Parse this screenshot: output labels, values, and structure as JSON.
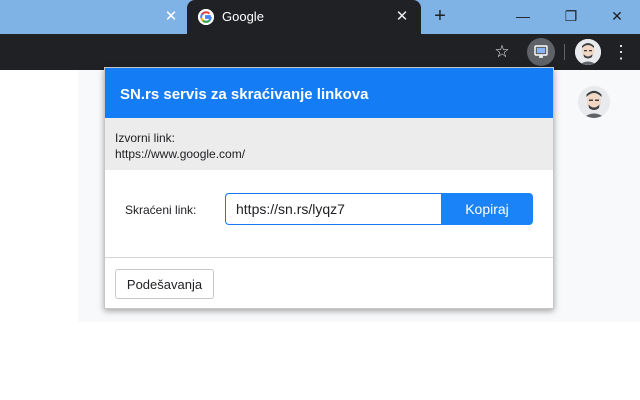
{
  "browser": {
    "tab": {
      "title": "Google",
      "close_glyph": "✕",
      "favicon": "google-g-icon"
    },
    "prev_tab_close_glyph": "✕",
    "new_tab_glyph": "+",
    "window": {
      "minimize_glyph": "—",
      "restore_glyph": "❐",
      "close_glyph": "✕"
    },
    "toolbar": {
      "star_glyph": "☆",
      "menu_glyph": "⋮",
      "extension_icon": "monitor-icon"
    }
  },
  "popup": {
    "title": "SN.rs servis za skraćivanje linkova",
    "source_label": "Izvorni link:",
    "source_url": "https://www.google.com/",
    "short_label": "Skraćeni link:",
    "short_url": "https://sn.rs/lyqz7",
    "copy_label": "Kopiraj",
    "settings_label": "Podešavanja"
  },
  "colors": {
    "accent": "#1a83f7",
    "tabstrip": "#7fb3e5",
    "toolbar": "#202124",
    "source_bg": "#ececec"
  }
}
